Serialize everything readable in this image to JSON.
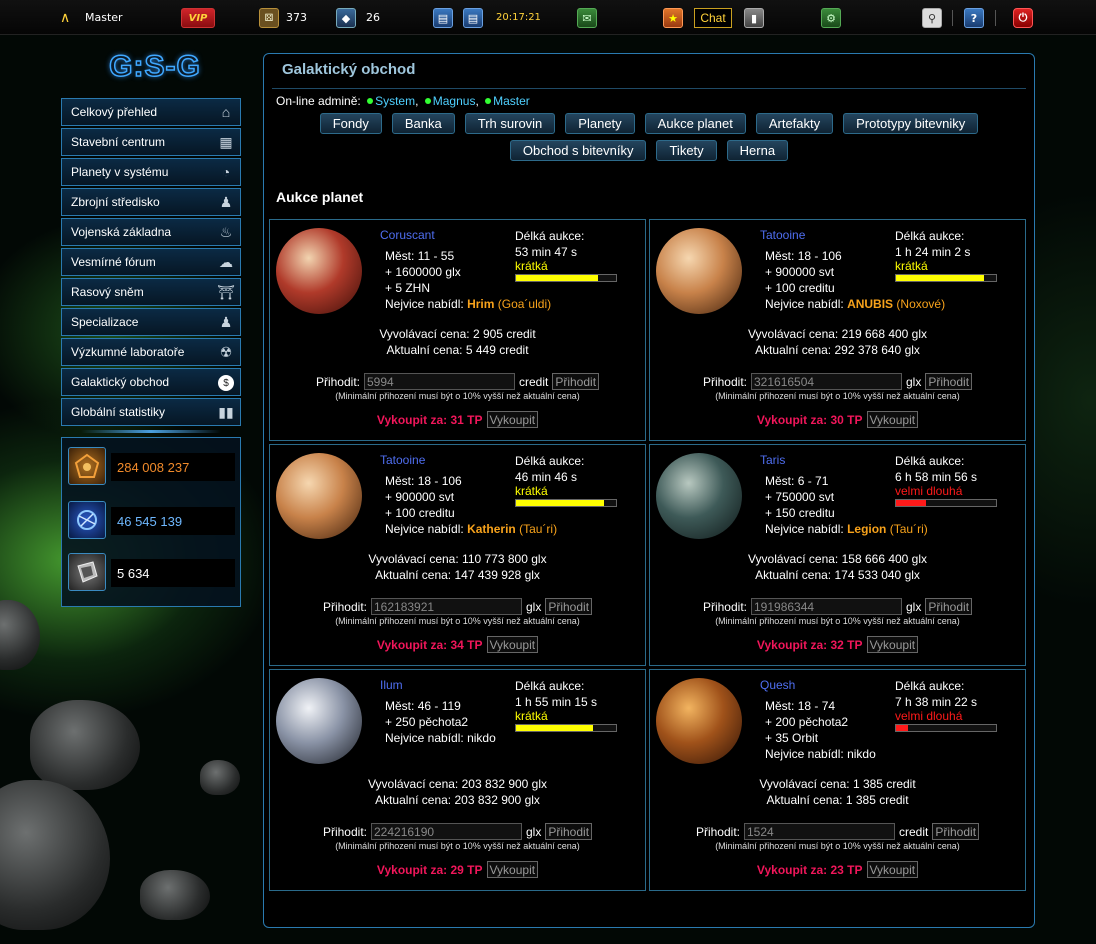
{
  "topbar": {
    "user": "Master",
    "vip_label": "VIP",
    "count_a": "373",
    "count_b": "26",
    "time": "20:17:21",
    "chat_label": "Chat"
  },
  "logo": "G:S-G",
  "sidebar": {
    "items": [
      {
        "label": "Celkový přehled",
        "icon": "home-icon"
      },
      {
        "label": "Stavební centrum",
        "icon": "building-icon"
      },
      {
        "label": "Planety v systému",
        "icon": "planet-icon"
      },
      {
        "label": "Zbrojní středisko",
        "icon": "soldier-icon"
      },
      {
        "label": "Vojenská základna",
        "icon": "base-icon"
      },
      {
        "label": "Vesmírné fórum",
        "icon": "chat-bubble-icon"
      },
      {
        "label": "Rasový sněm",
        "icon": "parliament-icon"
      },
      {
        "label": "Specializace",
        "icon": "people-icon"
      },
      {
        "label": "Výzkumné laboratoře",
        "icon": "radiation-icon"
      },
      {
        "label": "Galaktický obchod",
        "icon": "trade-icon"
      },
      {
        "label": "Globální statistiky",
        "icon": "chart-icon"
      }
    ]
  },
  "resources": [
    {
      "value": "284 008 237",
      "color": "#f08a2a",
      "icon": "gold-resource-icon"
    },
    {
      "value": "46 545 139",
      "color": "#6fb8ff",
      "icon": "energy-resource-icon"
    },
    {
      "value": "5 634",
      "color": "#ffffff",
      "icon": "metal-resource-icon"
    }
  ],
  "panel": {
    "title": "Galaktický obchod",
    "online_label": "On-line admině:",
    "admins": [
      "System",
      "Magnus",
      "Master"
    ],
    "tabs_row1": [
      "Fondy",
      "Banka",
      "Trh surovin",
      "Planety",
      "Aukce planet",
      "Artefakty",
      "Prototypy bitevniky"
    ],
    "tabs_row2": [
      "Obchod s bitevníky",
      "Tikety",
      "Herna"
    ],
    "section_title": "Aukce planet"
  },
  "labels": {
    "duration": "Délká aukce:",
    "start_price": "Vyvolávací cena:",
    "current_price": "Aktualní cena:",
    "bid": "Přihodit:",
    "bid_button": "Přihodit",
    "min_note": "(Minimální přihození musí být o 10% vyšší než aktuální cena)",
    "buyout": "Vykoupit za:",
    "buyout_button": "Vykoupit",
    "highest_bid": "Nejvice nabídl:",
    "cities": "Měst:"
  },
  "auctions": [
    {
      "planet": "Coruscant",
      "cities": "11 - 55",
      "rewards": [
        "+ 1600000 glx",
        "+ 5 ZHN"
      ],
      "bidder": "Hrim",
      "bidder_race": "(Goa´uldi)",
      "duration": "53 min 47 s",
      "duration_type": "krátká",
      "duration_color": "#ffff00",
      "remaining": 0.82,
      "start": "2 905 credit",
      "current": "5 449 credit",
      "bid_value": "5994",
      "currency": "credit",
      "buyout": "31 TP",
      "planet_colors": [
        "#f2d4b0",
        "#b03a2a",
        "#3a0d08"
      ]
    },
    {
      "planet": "Tatooine",
      "cities": "18 - 106",
      "rewards": [
        "+ 900000 svt",
        "+ 100 creditu"
      ],
      "bidder": "ANUBIS",
      "bidder_race": "(Noxové)",
      "duration": "1 h 24 min 2 s",
      "duration_type": "krátká",
      "duration_color": "#ffff00",
      "remaining": 0.88,
      "start": "219 668 400 glx",
      "current": "292 378 640 glx",
      "bid_value": "321616504",
      "currency": "glx",
      "buyout": "30 TP",
      "planet_colors": [
        "#f6d7b0",
        "#c8824a",
        "#3d1e0a"
      ]
    },
    {
      "planet": "Tatooine",
      "cities": "18 - 106",
      "rewards": [
        "+ 900000 svt",
        "+ 100 creditu"
      ],
      "bidder": "Katherin",
      "bidder_race": "(Tau´ri)",
      "duration": "46 min 46 s",
      "duration_type": "krátká",
      "duration_color": "#ffff00",
      "remaining": 0.88,
      "start": "110 773 800 glx",
      "current": "147 439 928 glx",
      "bid_value": "162183921",
      "currency": "glx",
      "buyout": "34 TP",
      "planet_colors": [
        "#f6d7b0",
        "#c8824a",
        "#3d1e0a"
      ]
    },
    {
      "planet": "Taris",
      "cities": "6 - 71",
      "rewards": [
        "+ 750000 svt",
        "+ 150 creditu"
      ],
      "bidder": "Legion",
      "bidder_race": "(Tau´ri)",
      "duration": "6 h 58 min 56 s",
      "duration_type": "velmi dlouhá",
      "duration_color": "#ff1a1a",
      "remaining": 0.3,
      "start": "158 666 400 glx",
      "current": "174 533 040 glx",
      "bid_value": "191986344",
      "currency": "glx",
      "buyout": "32 TP",
      "planet_colors": [
        "#b8c8c0",
        "#3e5a58",
        "#0d1616"
      ]
    },
    {
      "planet": "Ilum",
      "cities": "46 - 119",
      "rewards": [
        "+ 250 pěchota2"
      ],
      "bidder": "nikdo",
      "bidder_race": "",
      "duration": "1 h 55 min 15 s",
      "duration_type": "krátká",
      "duration_color": "#ffff00",
      "remaining": 0.77,
      "start": "203 832 900 glx",
      "current": "203 832 900 glx",
      "bid_value": "224216190",
      "currency": "glx",
      "buyout": "29 TP",
      "planet_colors": [
        "#f0f2f6",
        "#8a93a6",
        "#1a1d24"
      ]
    },
    {
      "planet": "Quesh",
      "cities": "18 - 74",
      "rewards": [
        "+ 200 pěchota2",
        "+ 35 Orbit"
      ],
      "bidder": "nikdo",
      "bidder_race": "",
      "duration": "7 h 38 min 22 s",
      "duration_type": "velmi dlouhá",
      "duration_color": "#ff1a1a",
      "remaining": 0.12,
      "start": "1 385 credit",
      "current": "1 385 credit",
      "bid_value": "1524",
      "currency": "credit",
      "buyout": "23 TP",
      "planet_colors": [
        "#f2b460",
        "#a0521a",
        "#2e1206"
      ]
    }
  ]
}
